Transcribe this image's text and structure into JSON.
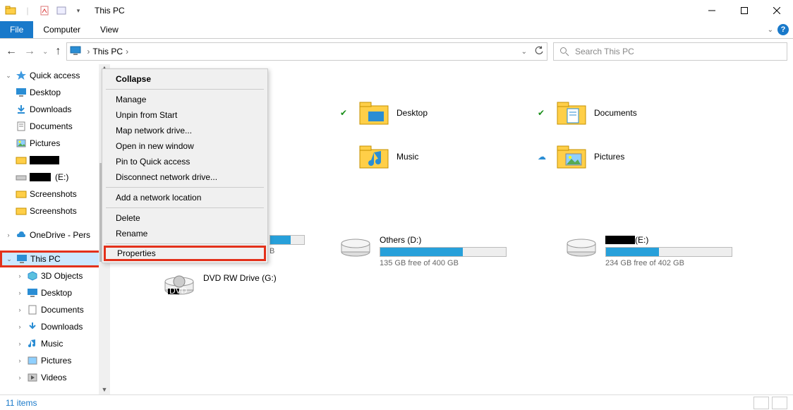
{
  "window": {
    "title": "This PC"
  },
  "ribbon": {
    "file": "File",
    "computer": "Computer",
    "view": "View"
  },
  "breadcrumb": {
    "root": "This PC"
  },
  "search": {
    "placeholder": "Search This PC"
  },
  "tree": {
    "quick_access": "Quick access",
    "desktop": "Desktop",
    "downloads": "Downloads",
    "documents": "Documents",
    "pictures": "Pictures",
    "redacted_folder": "",
    "e_drive": "(E:)",
    "screenshots1": "Screenshots",
    "screenshots2": "Screenshots",
    "onedrive": "OneDrive - Pers",
    "this_pc": "This PC",
    "objects3d": "3D Objects",
    "desktop2": "Desktop",
    "documents2": "Documents",
    "downloads2": "Downloads",
    "music": "Music",
    "pictures2": "Pictures",
    "videos": "Videos"
  },
  "context_menu": {
    "collapse": "Collapse",
    "manage": "Manage",
    "unpin": "Unpin from Start",
    "map_drive": "Map network drive...",
    "open_new": "Open in new window",
    "pin_quick": "Pin to Quick access",
    "disconnect": "Disconnect network drive...",
    "add_loc": "Add a network location",
    "delete": "Delete",
    "rename": "Rename",
    "properties": "Properties"
  },
  "folders": {
    "desktop": "Desktop",
    "documents": "Documents",
    "music": "Music",
    "pictures": "Pictures"
  },
  "drives": {
    "partial_hidden": "B",
    "others": {
      "name": "Others (D:)",
      "free": "135 GB free of 400 GB",
      "fill_pct": 66
    },
    "e": {
      "name": "(E:)",
      "free": "234 GB free of 402 GB",
      "fill_pct": 42
    },
    "dvd": "DVD RW Drive (G:)"
  },
  "status": {
    "items": "11 items"
  }
}
